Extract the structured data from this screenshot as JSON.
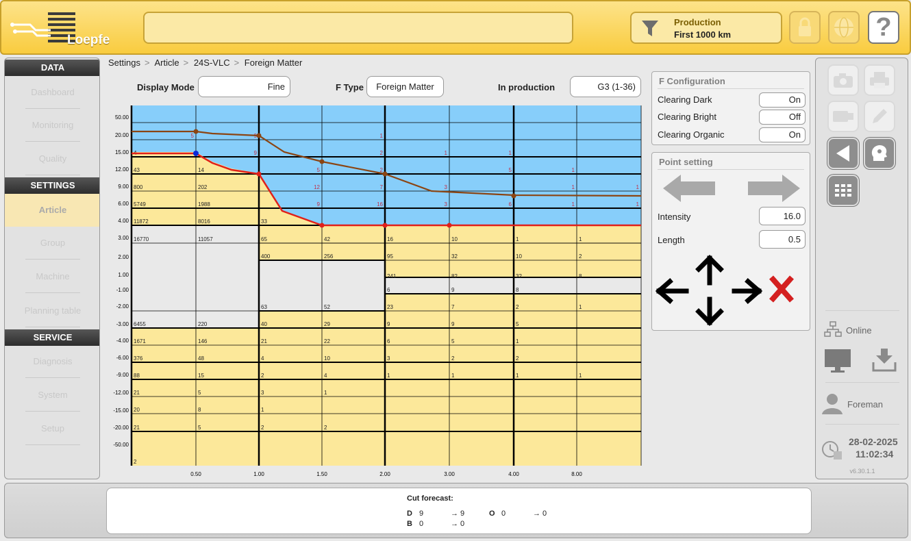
{
  "header": {
    "logo_text": "Loepfe",
    "message": "",
    "production_line1": "Production",
    "production_line2": "First 1000 km",
    "icons": [
      "funnel-icon",
      "lock-icon",
      "globe-icon",
      "help-icon"
    ],
    "help_label": "?"
  },
  "sidebar": {
    "sections": [
      {
        "title": "DATA",
        "items": [
          "Dashboard",
          "Monitoring",
          "Quality"
        ]
      },
      {
        "title": "SETTINGS",
        "items": [
          "Article",
          "Group",
          "Machine",
          "Planning table"
        ]
      },
      {
        "title": "SERVICE",
        "items": [
          "Diagnosis",
          "System",
          "Setup"
        ]
      }
    ],
    "active_item": "Article"
  },
  "breadcrumb": [
    "Settings",
    "Article",
    "24S-VLC",
    "Foreign Matter"
  ],
  "controls": {
    "display_mode_label": "Display Mode",
    "display_mode_value": "Fine",
    "ftype_label": "F Type",
    "ftype_value": "Foreign Matter",
    "in_production_label": "In production",
    "in_production_value": "G3 (1-36)"
  },
  "chart_data": {
    "type": "table",
    "x_tick_labels": [
      "0.50",
      "1.00",
      "1.50",
      "2.00",
      "3.00",
      "4.00",
      "8.00"
    ],
    "y_tick_labels_top": [
      "50.00",
      "20.00",
      "15.00",
      "12.00",
      "9.00",
      "6.00",
      "4.00",
      "3.00",
      "2.00",
      "1.00"
    ],
    "y_tick_labels_bottom": [
      "-1.00",
      "-2.00",
      "-3.00",
      "-4.00",
      "-6.00",
      "-9.00",
      "-12.00",
      "-15.00",
      "-20.00",
      "-50.00"
    ],
    "positive_counts": [
      {
        "row": 2,
        "col": 0,
        "value": "4"
      },
      {
        "row": 3,
        "col": 0,
        "value": "43"
      },
      {
        "row": 3,
        "col": 1,
        "value": "14"
      },
      {
        "row": 4,
        "col": 0,
        "value": "800"
      },
      {
        "row": 4,
        "col": 1,
        "value": "202"
      },
      {
        "row": 5,
        "col": 0,
        "value": "5749"
      },
      {
        "row": 5,
        "col": 1,
        "value": "1988"
      },
      {
        "row": 6,
        "col": 0,
        "value": "11872"
      },
      {
        "row": 6,
        "col": 1,
        "value": "8016"
      },
      {
        "row": 6,
        "col": 2,
        "value": "33"
      },
      {
        "row": 7,
        "col": 0,
        "value": "16770"
      },
      {
        "row": 7,
        "col": 1,
        "value": "11057"
      },
      {
        "row": 7,
        "col": 2,
        "value": "65"
      },
      {
        "row": 7,
        "col": 3,
        "value": "42"
      },
      {
        "row": 7,
        "col": 4,
        "value": "16"
      },
      {
        "row": 7,
        "col": 5,
        "value": "10"
      },
      {
        "row": 7,
        "col": 6,
        "value": "1"
      },
      {
        "row": 7,
        "col": 7,
        "value": "1"
      },
      {
        "row": 8,
        "col": 2,
        "value": "400"
      },
      {
        "row": 8,
        "col": 3,
        "value": "256"
      },
      {
        "row": 8,
        "col": 4,
        "value": "95"
      },
      {
        "row": 8,
        "col": 5,
        "value": "32"
      },
      {
        "row": 8,
        "col": 6,
        "value": "10"
      },
      {
        "row": 8,
        "col": 7,
        "value": "2"
      },
      {
        "row": 9,
        "col": 4,
        "value": "241"
      },
      {
        "row": 9,
        "col": 5,
        "value": "82"
      },
      {
        "row": 9,
        "col": 6,
        "value": "32"
      },
      {
        "row": 9,
        "col": 7,
        "value": "8"
      }
    ],
    "cut_counts": [
      {
        "row": 1,
        "col": 0,
        "value": "5"
      },
      {
        "row": 1,
        "col": 1,
        "value": "9"
      },
      {
        "row": 1,
        "col": 3,
        "value": "1"
      },
      {
        "row": 2,
        "col": 1,
        "value": "9"
      },
      {
        "row": 2,
        "col": 3,
        "value": "2"
      },
      {
        "row": 2,
        "col": 4,
        "value": "1"
      },
      {
        "row": 2,
        "col": 5,
        "value": "1"
      },
      {
        "row": 3,
        "col": 2,
        "value": "5"
      },
      {
        "row": 3,
        "col": 3,
        "value": "2"
      },
      {
        "row": 3,
        "col": 5,
        "value": "5"
      },
      {
        "row": 3,
        "col": 6,
        "value": "1"
      },
      {
        "row": 4,
        "col": 2,
        "value": "12"
      },
      {
        "row": 4,
        "col": 3,
        "value": "7"
      },
      {
        "row": 4,
        "col": 4,
        "value": "3"
      },
      {
        "row": 4,
        "col": 6,
        "value": "1"
      },
      {
        "row": 4,
        "col": 7,
        "value": "1"
      },
      {
        "row": 5,
        "col": 2,
        "value": "9"
      },
      {
        "row": 5,
        "col": 3,
        "value": "16"
      },
      {
        "row": 5,
        "col": 4,
        "value": "3"
      },
      {
        "row": 5,
        "col": 5,
        "value": "6"
      },
      {
        "row": 5,
        "col": 6,
        "value": "1"
      },
      {
        "row": 5,
        "col": 7,
        "value": "1"
      }
    ],
    "negative_counts": [
      {
        "row": 10,
        "col": 4,
        "value": "6"
      },
      {
        "row": 10,
        "col": 5,
        "value": "9"
      },
      {
        "row": 10,
        "col": 6,
        "value": "8"
      },
      {
        "row": 11,
        "col": 2,
        "value": "63"
      },
      {
        "row": 11,
        "col": 3,
        "value": "52"
      },
      {
        "row": 11,
        "col": 4,
        "value": "23"
      },
      {
        "row": 11,
        "col": 5,
        "value": "7"
      },
      {
        "row": 11,
        "col": 6,
        "value": "2"
      },
      {
        "row": 11,
        "col": 7,
        "value": "1"
      },
      {
        "row": 12,
        "col": 0,
        "value": "6455"
      },
      {
        "row": 12,
        "col": 1,
        "value": "220"
      },
      {
        "row": 12,
        "col": 2,
        "value": "40"
      },
      {
        "row": 12,
        "col": 3,
        "value": "29"
      },
      {
        "row": 12,
        "col": 4,
        "value": "9"
      },
      {
        "row": 12,
        "col": 5,
        "value": "9"
      },
      {
        "row": 12,
        "col": 6,
        "value": "5"
      },
      {
        "row": 13,
        "col": 0,
        "value": "1671"
      },
      {
        "row": 13,
        "col": 1,
        "value": "146"
      },
      {
        "row": 13,
        "col": 2,
        "value": "21"
      },
      {
        "row": 13,
        "col": 3,
        "value": "22"
      },
      {
        "row": 13,
        "col": 4,
        "value": "6"
      },
      {
        "row": 13,
        "col": 5,
        "value": "5"
      },
      {
        "row": 13,
        "col": 6,
        "value": "1"
      },
      {
        "row": 14,
        "col": 0,
        "value": "376"
      },
      {
        "row": 14,
        "col": 1,
        "value": "48"
      },
      {
        "row": 14,
        "col": 2,
        "value": "4"
      },
      {
        "row": 14,
        "col": 3,
        "value": "10"
      },
      {
        "row": 14,
        "col": 4,
        "value": "3"
      },
      {
        "row": 14,
        "col": 5,
        "value": "2"
      },
      {
        "row": 14,
        "col": 6,
        "value": "2"
      },
      {
        "row": 15,
        "col": 0,
        "value": "88"
      },
      {
        "row": 15,
        "col": 1,
        "value": "15"
      },
      {
        "row": 15,
        "col": 2,
        "value": "2"
      },
      {
        "row": 15,
        "col": 3,
        "value": "4"
      },
      {
        "row": 15,
        "col": 4,
        "value": "1"
      },
      {
        "row": 15,
        "col": 5,
        "value": "1"
      },
      {
        "row": 15,
        "col": 6,
        "value": "1"
      },
      {
        "row": 15,
        "col": 7,
        "value": "1"
      },
      {
        "row": 16,
        "col": 0,
        "value": "21"
      },
      {
        "row": 16,
        "col": 1,
        "value": "5"
      },
      {
        "row": 16,
        "col": 2,
        "value": "3"
      },
      {
        "row": 16,
        "col": 3,
        "value": "1"
      },
      {
        "row": 17,
        "col": 0,
        "value": "20"
      },
      {
        "row": 17,
        "col": 1,
        "value": "8"
      },
      {
        "row": 17,
        "col": 2,
        "value": "1"
      },
      {
        "row": 18,
        "col": 0,
        "value": "21"
      },
      {
        "row": 18,
        "col": 1,
        "value": "5"
      },
      {
        "row": 18,
        "col": 2,
        "value": "2"
      },
      {
        "row": 18,
        "col": 3,
        "value": "2"
      },
      {
        "row": 19,
        "col": 0,
        "value": "2"
      }
    ],
    "clearing_curve_brown": {
      "length": [
        0,
        0.5,
        1.0,
        1.25,
        1.5,
        2.0,
        2.5,
        4.0,
        8.0
      ],
      "intensity": [
        22,
        22,
        20,
        16,
        14,
        11,
        8.5,
        7.5,
        7.5
      ]
    },
    "clearing_curve_red": {
      "length": [
        0,
        0.5,
        0.75,
        1.0,
        1.25,
        1.5,
        2.0,
        3.0,
        8.0
      ],
      "intensity": [
        16,
        16,
        13,
        11.5,
        5.5,
        3.8,
        3.8,
        3.8,
        3.8
      ]
    },
    "colors": {
      "clear_zone": "#87cefa",
      "count_zone": "#fce89a",
      "curve_brown": "#8b4513",
      "curve_red": "#e0201a",
      "count_text": "#222222",
      "cut_text": "#c0304a"
    }
  },
  "f_configuration": {
    "title": "F Configuration",
    "rows": [
      {
        "label": "Clearing Dark",
        "value": "On"
      },
      {
        "label": "Clearing Bright",
        "value": "Off"
      },
      {
        "label": "Clearing Organic",
        "value": "On"
      }
    ]
  },
  "point_setting": {
    "title": "Point setting",
    "intensity_label": "Intensity",
    "intensity_value": "16.0",
    "length_label": "Length",
    "length_value": "0.5"
  },
  "toolbar": {
    "online_label": "Online",
    "user_label": "Foreman",
    "date": "28-02-2025",
    "time": "11:02:34",
    "version": "v6.30.1.1"
  },
  "footer": {
    "cut_forecast_title": "Cut forecast:",
    "d_label": "D",
    "d_value": "9",
    "d_arrow_value": "→  9",
    "o_label": "O",
    "o_value": "0",
    "o_arrow_value": "→  0",
    "b_label": "B",
    "b_value": "0",
    "b_arrow_value": "→  0"
  }
}
